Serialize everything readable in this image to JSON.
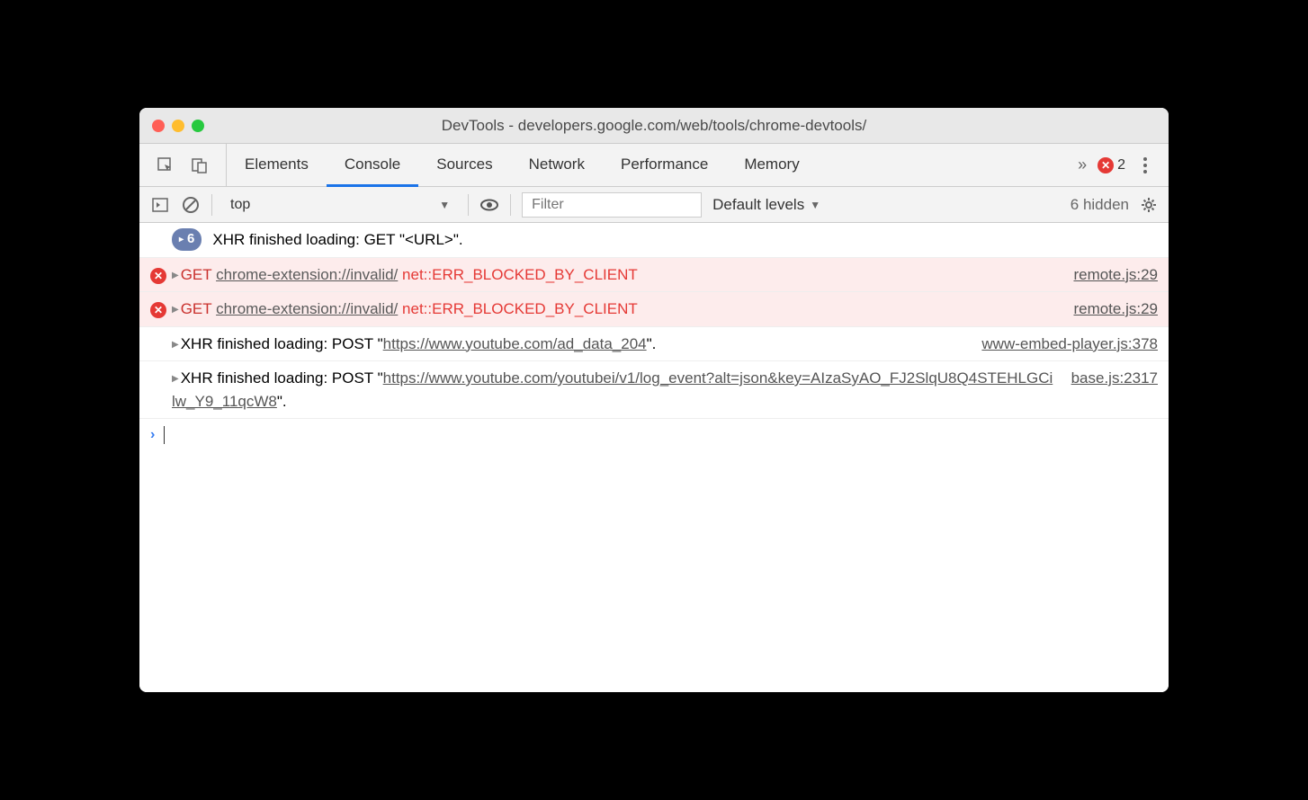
{
  "window": {
    "title": "DevTools - developers.google.com/web/tools/chrome-devtools/"
  },
  "tabs": {
    "items": [
      "Elements",
      "Console",
      "Sources",
      "Network",
      "Performance",
      "Memory"
    ],
    "activeIndex": 1,
    "errorCount": "2"
  },
  "toolbar": {
    "context": "top",
    "filterPlaceholder": "Filter",
    "levels": "Default levels",
    "hiddenText": "6 hidden"
  },
  "console": {
    "rows": [
      {
        "type": "count",
        "badge": "6",
        "text": "XHR finished loading: GET \"<URL>\"."
      },
      {
        "type": "error",
        "method": "GET",
        "url": "chrome-extension://invalid/",
        "errText": "net::ERR_BLOCKED_BY_CLIENT",
        "source": "remote.js:29"
      },
      {
        "type": "error",
        "method": "GET",
        "url": "chrome-extension://invalid/",
        "errText": "net::ERR_BLOCKED_BY_CLIENT",
        "source": "remote.js:29"
      },
      {
        "type": "log",
        "prefix": "XHR finished loading: POST \"",
        "url": "https://www.youtube.com/ad_data_204",
        "suffix": "\".",
        "source": "www-embed-player.js:378"
      },
      {
        "type": "log",
        "prefix": "XHR finished loading: POST \"",
        "url": "https://www.youtube.com/youtubei/v1/log_event?alt=json&key=AIzaSyAO_FJ2SlqU8Q4STEHLGCilw_Y9_11qcW8",
        "suffix": "\".",
        "source": "base.js:2317"
      }
    ]
  }
}
